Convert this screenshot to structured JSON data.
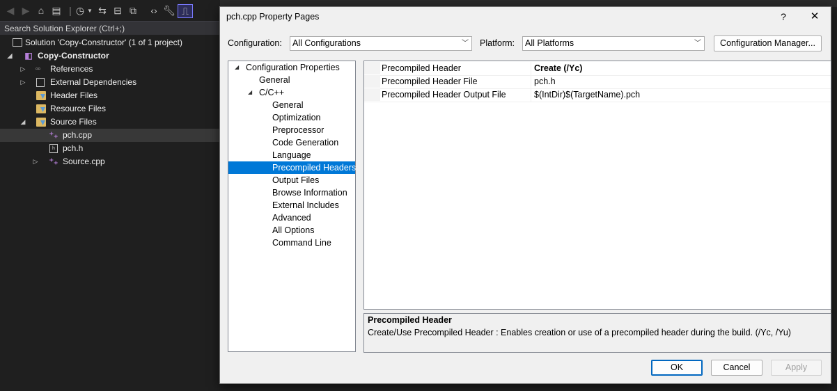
{
  "solution_explorer": {
    "search_placeholder": "Search Solution Explorer (Ctrl+;)",
    "tree": [
      {
        "label": "Solution 'Copy-Constructor' (1 of 1 project)",
        "icon": "solution-icon"
      },
      {
        "label": "Copy-Constructor",
        "icon": "project-icon"
      },
      {
        "label": "References",
        "icon": "references-icon"
      },
      {
        "label": "External Dependencies",
        "icon": "dependencies-icon"
      },
      {
        "label": "Header Files",
        "icon": "folder-icon"
      },
      {
        "label": "Resource Files",
        "icon": "folder-icon"
      },
      {
        "label": "Source Files",
        "icon": "folder-icon"
      },
      {
        "label": "pch.cpp",
        "icon": "cpp-file-icon"
      },
      {
        "label": "pch.h",
        "icon": "header-file-icon"
      },
      {
        "label": "Source.cpp",
        "icon": "cpp-file-icon"
      }
    ]
  },
  "dialog": {
    "title": "pch.cpp Property Pages",
    "help": "?",
    "close": "✕",
    "configuration_label": "Configuration:",
    "configuration_value": "All Configurations",
    "platform_label": "Platform:",
    "platform_value": "All Platforms",
    "config_manager": "Configuration Manager...",
    "nav": [
      {
        "label": "Configuration Properties"
      },
      {
        "label": "General"
      },
      {
        "label": "C/C++"
      },
      {
        "label": "General"
      },
      {
        "label": "Optimization"
      },
      {
        "label": "Preprocessor"
      },
      {
        "label": "Code Generation"
      },
      {
        "label": "Language"
      },
      {
        "label": "Precompiled Headers"
      },
      {
        "label": "Output Files"
      },
      {
        "label": "Browse Information"
      },
      {
        "label": "External Includes"
      },
      {
        "label": "Advanced"
      },
      {
        "label": "All Options"
      },
      {
        "label": "Command Line"
      }
    ],
    "properties": [
      {
        "name": "Precompiled Header",
        "value": "Create (/Yc)"
      },
      {
        "name": "Precompiled Header File",
        "value": "pch.h"
      },
      {
        "name": "Precompiled Header Output File",
        "value": "$(IntDir)$(TargetName).pch"
      }
    ],
    "description": {
      "title": "Precompiled Header",
      "text": "Create/Use Precompiled Header : Enables creation or use of a precompiled header during the build.     (/Yc, /Yu)"
    },
    "buttons": {
      "ok": "OK",
      "cancel": "Cancel",
      "apply": "Apply"
    }
  },
  "colors": {
    "selection": "#0078d7",
    "dark_bg": "#1f1f1f"
  }
}
